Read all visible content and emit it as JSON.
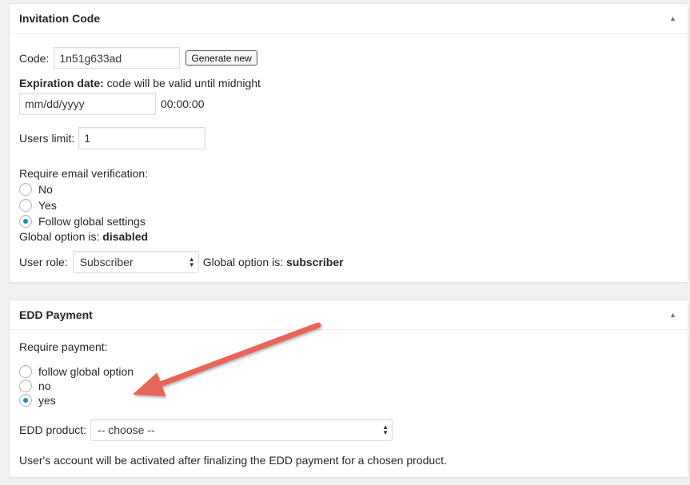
{
  "invitation": {
    "title": "Invitation Code",
    "code_label": "Code:",
    "code_value": "1n51g633ad",
    "generate_label": "Generate new",
    "expiration_label_bold": "Expiration date:",
    "expiration_label_rest": " code will be valid until midnight",
    "date_placeholder": "mm/dd/yyyy",
    "time_text": "00:00:00",
    "users_limit_label": "Users limit:",
    "users_limit_value": "1",
    "email_verification_label": "Require email verification:",
    "email_options": [
      "No",
      "Yes",
      "Follow global settings"
    ],
    "email_selected": "Follow global settings",
    "global_option_prefix": "Global option is: ",
    "global_email_value": "disabled",
    "user_role_label": "User role:",
    "user_role_value": "Subscriber",
    "global_role_value": "subscriber"
  },
  "edd": {
    "title": "EDD Payment",
    "require_payment_label": "Require payment:",
    "payment_options": [
      "follow global option",
      "no",
      "yes"
    ],
    "payment_selected": "yes",
    "product_label": "EDD product:",
    "product_value": "-- choose --",
    "info_text": "User's account will be activated after finalizing the EDD payment for a chosen product."
  },
  "icons": {
    "collapse": "triangle-up-icon",
    "select_arrows": "updown-arrows-icon"
  },
  "colors": {
    "radio_checked": "#1e8cbe",
    "annotation_arrow": "#e8655a"
  }
}
